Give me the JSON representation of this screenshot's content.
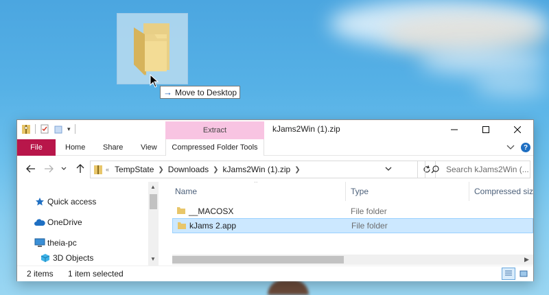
{
  "drag": {
    "tooltip_label": "Move to Desktop",
    "icons": [
      "folder-icon",
      "mouse-cursor-icon",
      "arrow-right-icon"
    ]
  },
  "window": {
    "title": "kJams2Win (1).zip",
    "contextual_header": "Extract",
    "quick_access_icons": [
      "zip-folder-icon",
      "properties-icon",
      "new-folder-icon",
      "customize-dropdown-icon"
    ],
    "controls": [
      "minimize-icon",
      "maximize-icon",
      "close-icon"
    ]
  },
  "ribbon": {
    "tabs": [
      "File",
      "Home",
      "Share",
      "View",
      "Compressed Folder Tools"
    ],
    "accent_color": "#b8164a",
    "contextual_color": "#f8c4e2"
  },
  "navbar": {
    "overflow": "«",
    "breadcrumbs": [
      "TempState",
      "Downloads",
      "kJams2Win (1).zip"
    ],
    "search_placeholder": "Search kJams2Win (..."
  },
  "nav_pane": {
    "items": [
      {
        "label": "Quick access",
        "icon": "star-icon"
      },
      {
        "label": "OneDrive",
        "icon": "cloud-icon"
      },
      {
        "label": "theia-pc",
        "icon": "computer-icon"
      },
      {
        "label": "3D Objects",
        "icon": "cube-icon"
      }
    ]
  },
  "file_list": {
    "columns": [
      "Name",
      "Type",
      "Compressed size"
    ],
    "rows": [
      {
        "name": "__MACOSX",
        "type": "File folder",
        "selected": false
      },
      {
        "name": "kJams 2.app",
        "type": "File folder",
        "selected": true
      }
    ],
    "selection_color": "#cce8ff"
  },
  "status": {
    "item_count": "2 items",
    "selection": "1 item selected"
  }
}
